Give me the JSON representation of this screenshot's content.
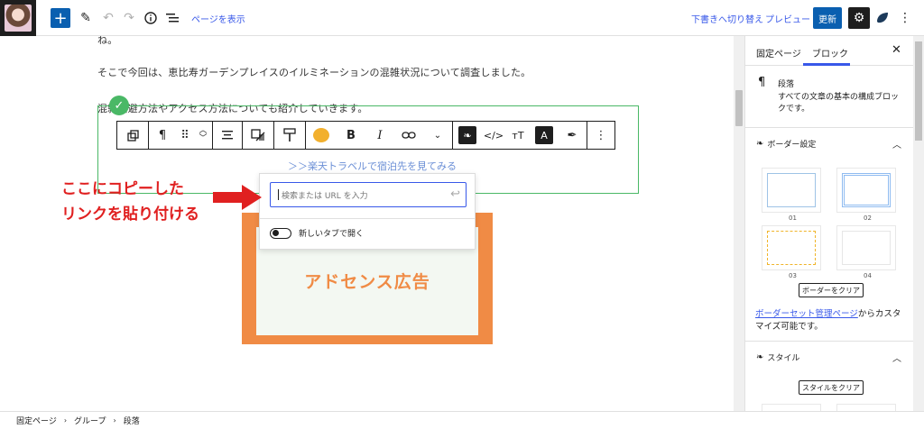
{
  "topbar": {
    "add_icon": "plus-icon",
    "show_page": "ページを表示",
    "switch_draft": "下書きへ切り替え",
    "preview": "プレビュー",
    "update": "更新",
    "settings_icon": "gear-icon"
  },
  "content": {
    "partial_line": "ね。",
    "para1": "そこで今回は、恵比寿ガーデンプレイスのイルミネーションの混雑状況について調査しました。",
    "para2": "混雑回避方法やアクセス方法についても紹介していきます。",
    "link_text": "＞＞楽天トラベルで宿泊先を見てみる",
    "ad_label": "アドセンス広告"
  },
  "toolbar": {
    "paragraph": "¶",
    "bold": "B",
    "italic": "I",
    "text_size": "тT",
    "highlight": "A"
  },
  "link_popover": {
    "placeholder": "検索または URL を入力",
    "new_tab": "新しいタブで開く"
  },
  "annotation": {
    "line1": "ここにコピーした",
    "line2": "リンクを貼り付ける"
  },
  "sidebar": {
    "tab_page": "固定ページ",
    "tab_block": "ブロック",
    "block_name": "段落",
    "block_description": "すべての文章の基本の構成ブロックです。",
    "border_panel_title": "ボーダー設定",
    "border_styles": [
      "01",
      "02",
      "03",
      "04"
    ],
    "clear_border": "ボーダーをクリア",
    "border_link": "ボーダーセット管理ページ",
    "border_note_rest": "からカスタマイズ可能です。",
    "style_panel_title": "スタイル",
    "clear_style": "スタイルをクリア"
  },
  "breadcrumb": [
    "固定ページ",
    "グループ",
    "段落"
  ],
  "colors": {
    "accent": "#3858e9",
    "primary_button": "#0a5fb0",
    "selection_green": "#4ab866",
    "ad_orange": "#f08b45",
    "annotation_red": "#e02020"
  }
}
